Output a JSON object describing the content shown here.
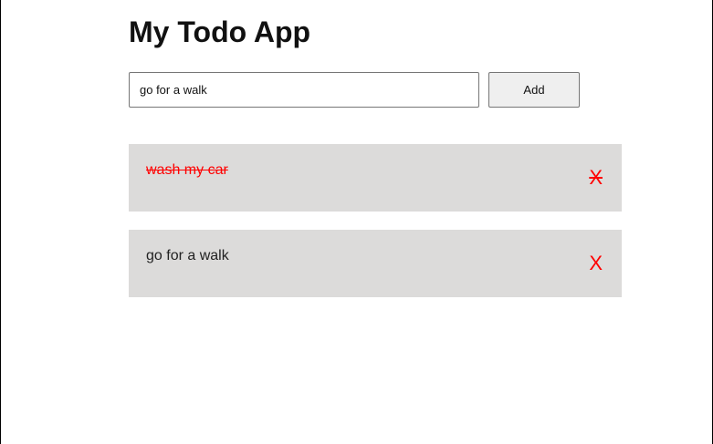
{
  "app": {
    "title": "My Todo App"
  },
  "form": {
    "input_value": "go for a walk",
    "add_label": "Add"
  },
  "todos": [
    {
      "text": "wash my car",
      "completed": true,
      "delete_label": "X"
    },
    {
      "text": "go for a walk",
      "completed": false,
      "delete_label": "X"
    }
  ],
  "colors": {
    "item_background": "#dcdbda",
    "completed_text": "#ff0000",
    "delete_icon": "#ff0000"
  }
}
